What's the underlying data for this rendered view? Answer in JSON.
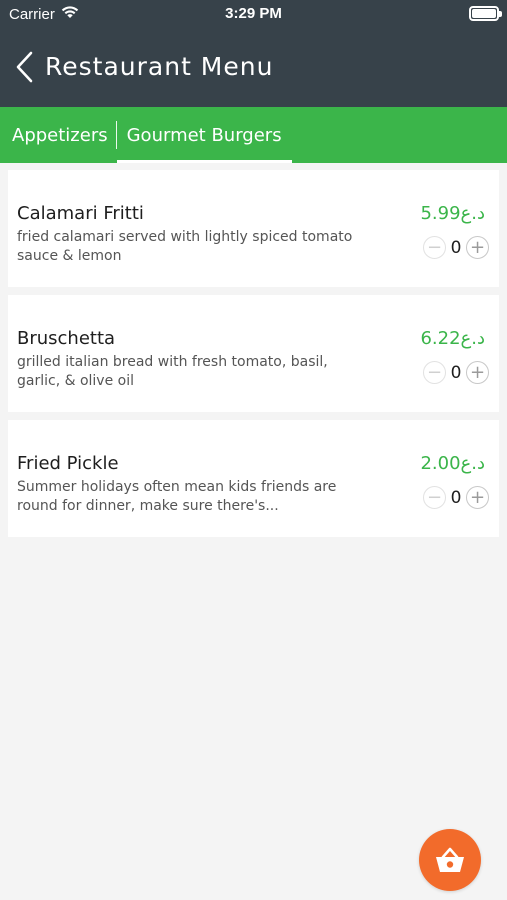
{
  "status_bar": {
    "carrier": "Carrier",
    "time": "3:29 PM"
  },
  "navbar": {
    "title": "Restaurant Menu",
    "back_icon": "chevron-left-icon"
  },
  "tabs": [
    {
      "label": "Appetizers",
      "active": false
    },
    {
      "label": "Gourmet Burgers",
      "active": true
    }
  ],
  "items": [
    {
      "name": "Calamari Fritti",
      "description": "fried calamari served with lightly spiced tomato sauce & lemon",
      "price": "5.99د.ع",
      "quantity": "0"
    },
    {
      "name": "Bruschetta",
      "description": "grilled italian bread with fresh tomato, basil, garlic, & olive oil",
      "price": "6.22د.ع",
      "quantity": "0"
    },
    {
      "name": "Fried Pickle",
      "description": "Summer holidays often mean kids friends are round for dinner, make sure there's...",
      "price": "2.00د.ع",
      "quantity": "0"
    }
  ],
  "stepper": {
    "minus": "−",
    "plus": "+"
  },
  "cart": {
    "icon": "basket-icon"
  },
  "colors": {
    "header": "#37424a",
    "accent": "#3bb54a",
    "fab": "#f26b2b",
    "background": "#f4f4f4"
  }
}
